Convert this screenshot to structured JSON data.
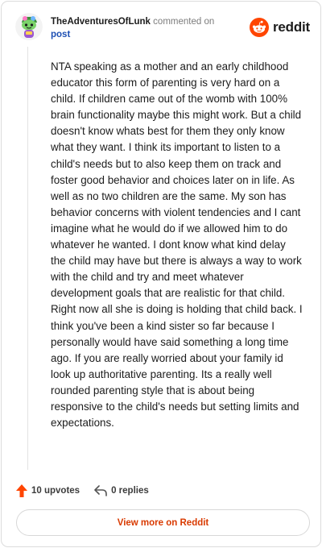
{
  "header": {
    "username": "TheAdventuresOfLunk",
    "action_text": "commented on",
    "post_link": "post",
    "brand": "reddit"
  },
  "comment": {
    "body": "NTA speaking as a mother and an early childhood educator this form of parenting is very hard on a child. If children came out of the womb with 100% brain functionality maybe this might work. But a child doesn't know whats best for them they only know what they want. I think its important to listen to a child's needs but to also keep them on track and foster good behavior and choices later on in life. As well as no two children are the same. My son has behavior concerns with violent tendencies and I cant imagine what he would do if we allowed him to do whatever he wanted. I dont know what kind delay the child may have but there is always a way to work with the child and try and meet whatever development goals that are realistic for that child. Right now all she is doing is holding that child back. I think you've been a kind sister so far because I personally would have said something a long time ago. If you are really worried about your family id look up authoritative parenting. Its a really well rounded parenting style that is about being responsive to the child's needs but setting limits and expectations."
  },
  "actions": {
    "upvotes": "10 upvotes",
    "replies": "0 replies"
  },
  "footer": {
    "view_more": "View more on Reddit"
  },
  "colors": {
    "reddit_orange": "#ff4500",
    "link_blue": "#1d4fb3",
    "view_more_text": "#d93a00"
  },
  "icons": {
    "avatar": "snoo-avatar",
    "logo": "reddit-alien-icon",
    "upvote": "upvote-arrow-icon",
    "reply": "reply-arrow-icon"
  }
}
